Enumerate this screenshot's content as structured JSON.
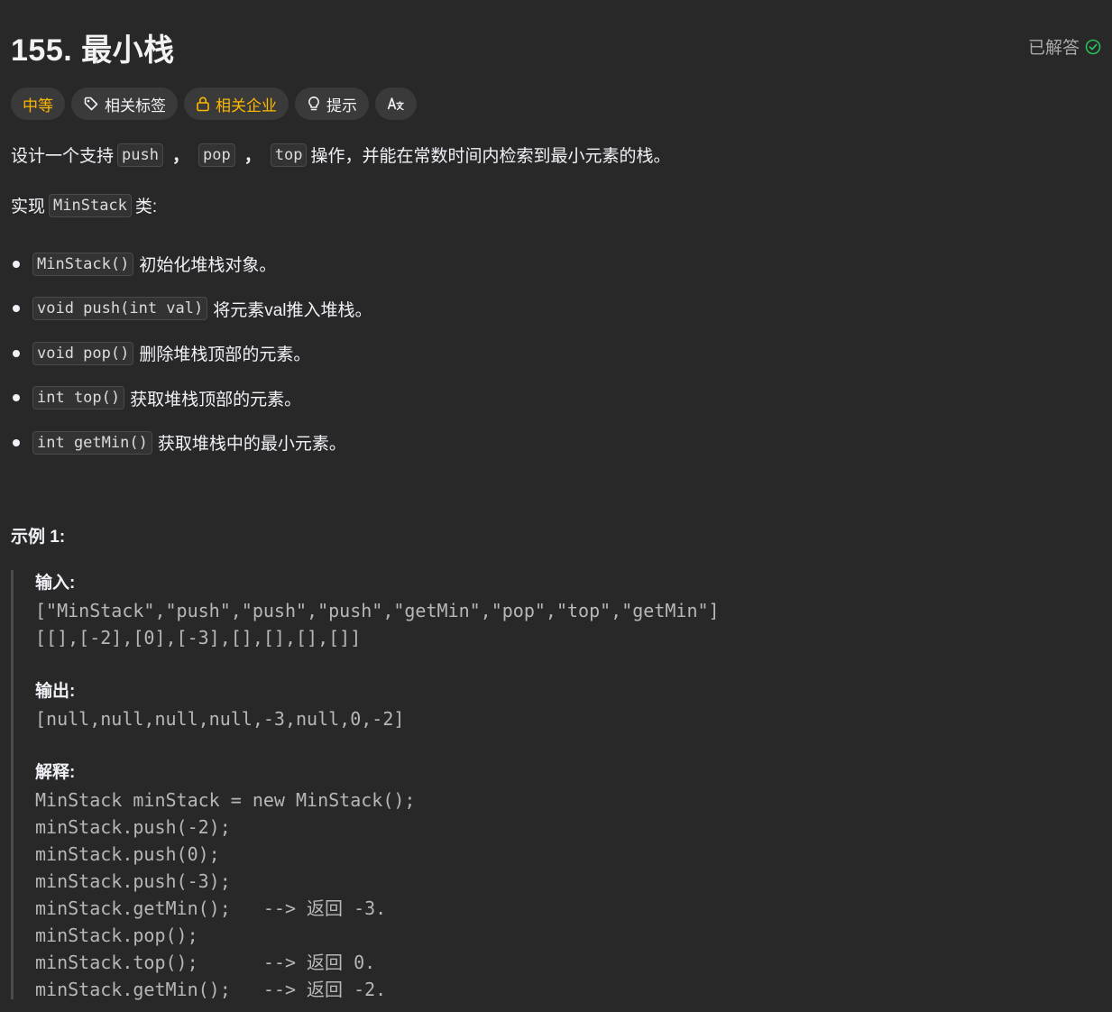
{
  "header": {
    "title": "155. 最小栈",
    "status": "已解答"
  },
  "tags": {
    "difficulty": "中等",
    "related_tags": "相关标签",
    "related_companies": "相关企业",
    "hint": "提示",
    "translate_icon": "translate-icon"
  },
  "description": {
    "intro_prefix": "设计一个支持",
    "code_push": "push",
    "sep1": "，",
    "code_pop": "pop",
    "sep2": "，",
    "code_top": "top",
    "intro_suffix": "操作，并能在常数时间内检索到最小元素的栈。",
    "impl_prefix": "实现",
    "impl_code": "MinStack",
    "impl_suffix": "类:",
    "bullets": [
      {
        "code": "MinStack()",
        "text": "初始化堆栈对象。"
      },
      {
        "code": "void push(int val)",
        "text": "将元素val推入堆栈。"
      },
      {
        "code": "void pop()",
        "text": "删除堆栈顶部的元素。"
      },
      {
        "code": "int top()",
        "text": "获取堆栈顶部的元素。"
      },
      {
        "code": "int getMin()",
        "text": "获取堆栈中的最小元素。"
      }
    ]
  },
  "example": {
    "title": "示例 1:",
    "input_label": "输入:",
    "input_line1": "[\"MinStack\",\"push\",\"push\",\"push\",\"getMin\",\"pop\",\"top\",\"getMin\"]",
    "input_line2": "[[],[-2],[0],[-3],[],[],[],[]]",
    "output_label": "输出:",
    "output_line": "[null,null,null,null,-3,null,0,-2]",
    "explain_label": "解释:",
    "explain_lines": [
      "MinStack minStack = new MinStack();",
      "minStack.push(-2);",
      "minStack.push(0);",
      "minStack.push(-3);",
      "minStack.getMin();   --> 返回 -3.",
      "minStack.pop();",
      "minStack.top();      --> 返回 0.",
      "minStack.getMin();   --> 返回 -2."
    ]
  },
  "colors": {
    "background": "#282828",
    "accent_yellow": "#ffb800",
    "solved_green": "#2cbb5d"
  }
}
